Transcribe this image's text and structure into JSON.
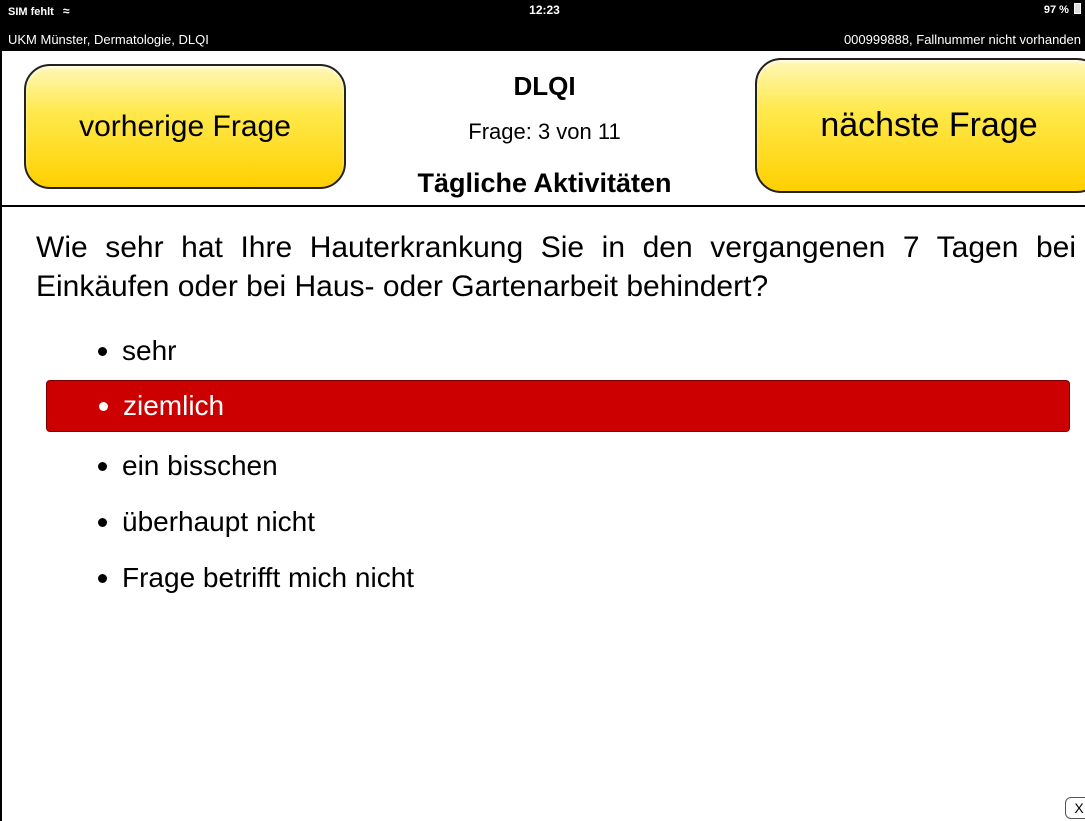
{
  "statusbar": {
    "carrier": "SIM fehlt",
    "wifi_icon": "wifi-icon",
    "time": "12:23",
    "battery": "97 %",
    "battery_icon": "battery-icon",
    "context": "UKM Münster, Dermatologie, DLQI",
    "case": "000999888, Fallnummer nicht vorhanden"
  },
  "header": {
    "prev_label": "vorherige Frage",
    "next_label": "nächste Frage",
    "title": "DLQI",
    "counter": "Frage: 3 von 11",
    "section": "Tägliche Aktivitäten"
  },
  "question": {
    "text": "Wie sehr hat Ihre Hauterkrankung Sie in den vergangenen 7 Tagen bei Einkäufen oder bei Haus- oder Gartenarbeit behindert?"
  },
  "options": [
    {
      "label": "sehr",
      "selected": false
    },
    {
      "label": "ziemlich",
      "selected": true
    },
    {
      "label": "ein bisschen",
      "selected": false
    },
    {
      "label": "überhaupt nicht",
      "selected": false
    },
    {
      "label": "Frage betrifft mich nicht",
      "selected": false
    }
  ],
  "colors": {
    "selected_bg": "#cc0000",
    "button_yellow": "#ffe94d"
  },
  "close_label": "X"
}
